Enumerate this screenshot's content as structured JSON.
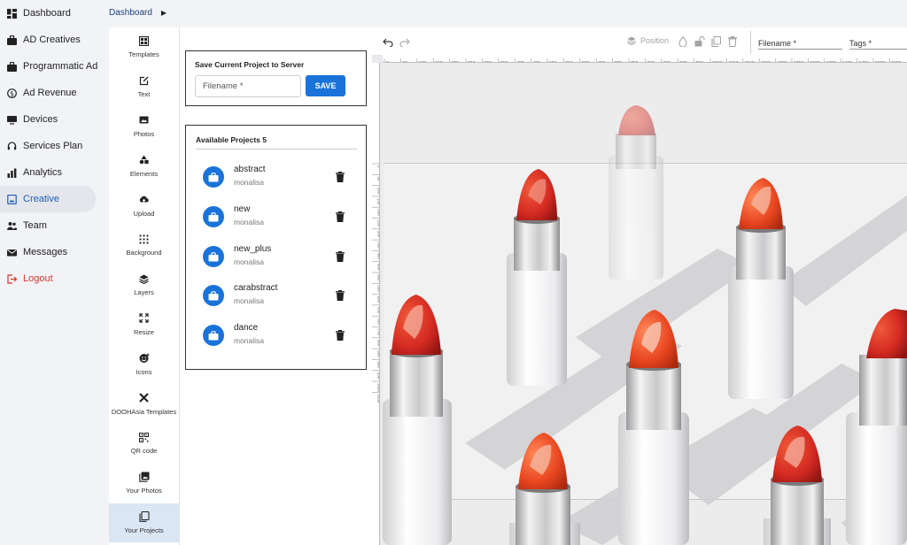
{
  "sidebar": {
    "items": [
      {
        "label": "Dashboard",
        "icon": "dashboard-icon"
      },
      {
        "label": "AD Creatives",
        "icon": "briefcase-icon"
      },
      {
        "label": "Programmatic Ad",
        "icon": "briefcase-icon"
      },
      {
        "label": "Ad Revenue",
        "icon": "dollar-icon"
      },
      {
        "label": "Devices",
        "icon": "monitor-icon"
      },
      {
        "label": "Services Plan",
        "icon": "headset-icon"
      },
      {
        "label": "Analytics",
        "icon": "bar-chart-icon"
      },
      {
        "label": "Creative",
        "icon": "image-icon"
      },
      {
        "label": "Team",
        "icon": "team-icon"
      },
      {
        "label": "Messages",
        "icon": "mail-icon"
      },
      {
        "label": "Logout",
        "icon": "logout-icon"
      }
    ],
    "active": "Creative"
  },
  "breadcrumb": {
    "current": "Dashboard"
  },
  "tools": [
    {
      "label": "Templates",
      "icon": "templates-icon"
    },
    {
      "label": "Text",
      "icon": "text-icon"
    },
    {
      "label": "Photos",
      "icon": "photos-icon"
    },
    {
      "label": "Elements",
      "icon": "elements-icon"
    },
    {
      "label": "Upload",
      "icon": "upload-icon"
    },
    {
      "label": "Background",
      "icon": "background-icon"
    },
    {
      "label": "Layers",
      "icon": "layers-icon"
    },
    {
      "label": "Resize",
      "icon": "resize-icon"
    },
    {
      "label": "Icons",
      "icon": "emoji-icon"
    },
    {
      "label": "DOOHAsia Templates",
      "icon": "design-tools-icon"
    },
    {
      "label": "QR code",
      "icon": "qr-code-icon"
    },
    {
      "label": "Your Photos",
      "icon": "your-photos-icon"
    },
    {
      "label": "Your Projects",
      "icon": "your-projects-icon"
    }
  ],
  "save_panel": {
    "title": "Save Current Project to Server",
    "filename_placeholder": "Filename *",
    "save_label": "SAVE"
  },
  "projects_panel": {
    "title": "Available Projects 5",
    "projects": [
      {
        "name": "abstract",
        "owner": "monalisa"
      },
      {
        "name": "new",
        "owner": "monalisa"
      },
      {
        "name": "new_plus",
        "owner": "monalisa"
      },
      {
        "name": "carabstract",
        "owner": "monalisa"
      },
      {
        "name": "dance",
        "owner": "monalisa"
      }
    ]
  },
  "editor": {
    "position_label": "Position",
    "filename_label": "Filename *",
    "tags_label": "Tags *",
    "ruler_h": [
      "0",
      "50",
      "100",
      "150",
      "200",
      "250",
      "300",
      "350",
      "400",
      "450",
      "500",
      "550",
      "600",
      "650",
      "700",
      "750",
      "800",
      "850",
      "900",
      "950",
      "1000",
      "1050",
      "1100",
      "1150",
      "1200",
      "1250",
      "1300",
      "1350",
      "1400",
      "1450",
      "1500",
      "1550"
    ],
    "ruler_v": [
      "0",
      "50",
      "100",
      "150",
      "200",
      "250",
      "300",
      "350",
      "400",
      "450",
      "500",
      "550",
      "600",
      "650",
      "700",
      "750",
      "800",
      "850",
      "900",
      "950",
      "1000",
      "1050"
    ]
  },
  "colors": {
    "accent": "#1a73d9",
    "active_text": "#1e5fb3",
    "logout": "#d9362b",
    "lipstick_red": "#d42a22",
    "lipstick_orange": "#e8451f"
  }
}
